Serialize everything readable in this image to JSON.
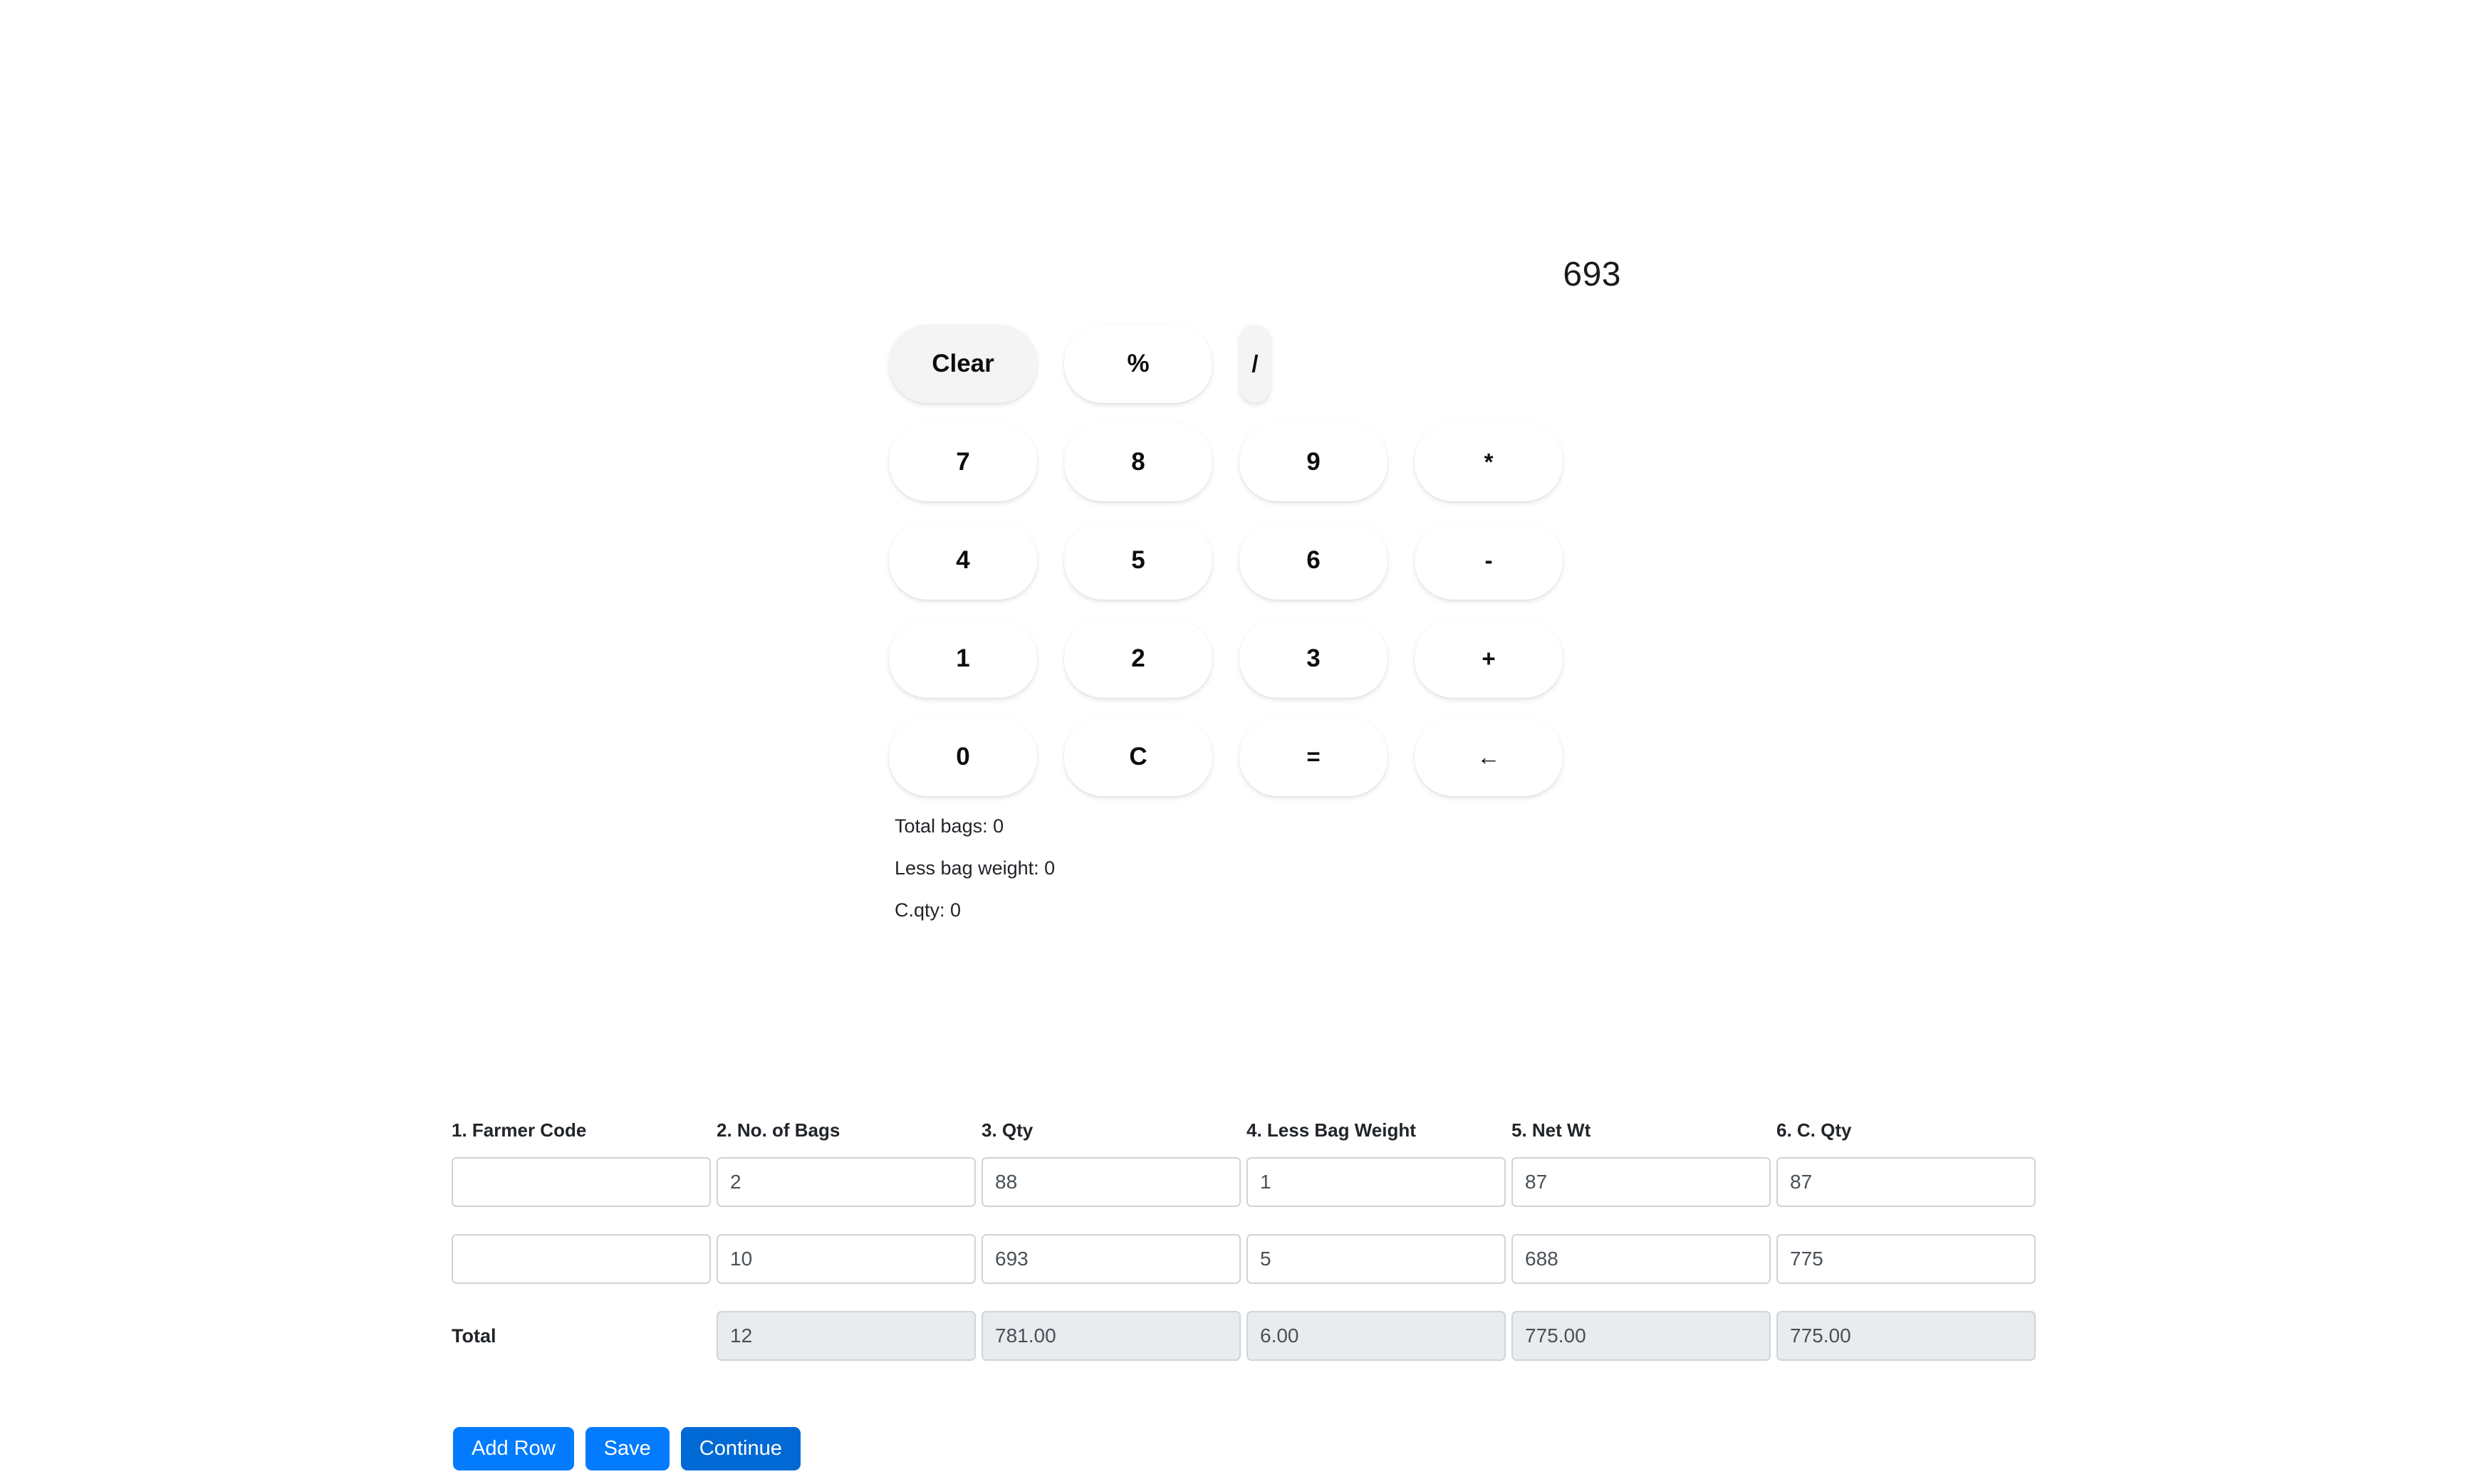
{
  "calculator": {
    "display_value": "693",
    "keys": {
      "clear": "Clear",
      "percent": "%",
      "divide": "/",
      "seven": "7",
      "eight": "8",
      "nine": "9",
      "multiply": "*",
      "four": "4",
      "five": "5",
      "six": "6",
      "minus": "-",
      "one": "1",
      "two": "2",
      "three": "3",
      "plus": "+",
      "zero": "0",
      "c": "C",
      "equals": "=",
      "backspace": "←"
    },
    "summary": {
      "total_bags": "Total bags: 0",
      "less_bag_weight": "Less bag weight: 0",
      "c_qty": "C.qty: 0"
    }
  },
  "table": {
    "headers": [
      "1. Farmer Code",
      "2. No. of Bags",
      "3. Qty",
      "4. Less Bag Weight",
      "5. Net Wt",
      "6. C. Qty"
    ],
    "rows": [
      {
        "farmer_code": "",
        "no_of_bags": "2",
        "qty": "88",
        "less_bag_weight": "1",
        "net_wt": "87",
        "c_qty": "87"
      },
      {
        "farmer_code": "",
        "no_of_bags": "10",
        "qty": "693",
        "less_bag_weight": "5",
        "net_wt": "688",
        "c_qty": "775"
      }
    ],
    "total": {
      "label": "Total",
      "no_of_bags": "12",
      "qty": "781.00",
      "less_bag_weight": "6.00",
      "net_wt": "775.00",
      "c_qty": "775.00"
    }
  },
  "actions": {
    "add_row": "Add Row",
    "save": "Save",
    "continue": "Continue"
  },
  "colors": {
    "primary_button": "#027bff",
    "primary_button_dark": "#0069d4",
    "key_grey": "#f4f4f4",
    "input_border": "#ced4da",
    "disabled_bg": "#e9ecef"
  }
}
